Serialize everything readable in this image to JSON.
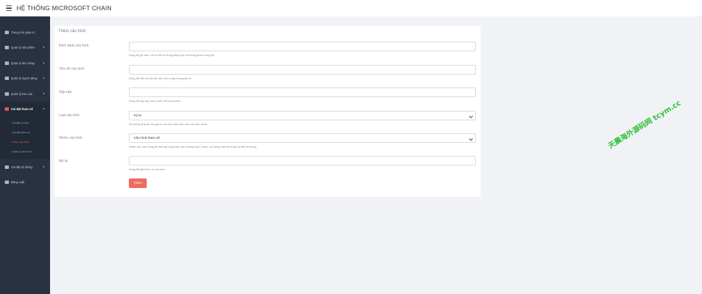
{
  "app": {
    "title": "HỆ THỐNG MICROSOFT CHAIN"
  },
  "sidebar": {
    "items": [
      {
        "label": "Trang chủ quản trị",
        "icon": "dashboard-icon",
        "has_caret": false
      },
      {
        "label": "Quản lý sản phẩm",
        "icon": "box-icon",
        "has_caret": true
      },
      {
        "label": "Quản lý đơn hàng",
        "icon": "file-icon",
        "has_caret": true
      },
      {
        "label": "Quản lý người dùng",
        "icon": "user-icon",
        "has_caret": true
      },
      {
        "label": "Quản lý báo cáo",
        "icon": "chart-icon",
        "has_caret": true
      },
      {
        "label": "Cài đặt tham số",
        "icon": "book-icon",
        "has_caret": true,
        "active": true
      },
      {
        "label": "Cài đặt hệ thống",
        "icon": "gear-icon",
        "has_caret": true
      },
      {
        "label": "Đăng xuất",
        "icon": "logout-icon",
        "has_caret": false
      }
    ],
    "submenu": [
      {
        "label": "Cài đặt cơ bản"
      },
      {
        "label": "Cài đặt tham số"
      },
      {
        "label": "Thêm cấu hình",
        "current": true
      },
      {
        "label": "Quản lý cấu hình"
      }
    ]
  },
  "form": {
    "title": "Thêm cấu hình",
    "fields": [
      {
        "label": "Định danh cấu hình",
        "value": "",
        "help": "Dùng để gọi hàm, chỉ có thể sử dụng tiếng Anh và không được trùng lặp"
      },
      {
        "label": "Tiêu đề cấu hình",
        "value": "",
        "help": "Dùng để hiển thị tiêu đề cấu hình trong trang quản trị"
      },
      {
        "label": "Sắp xếp",
        "value": "",
        "help": "Dùng để sắp xếp thứ tự hiển thị trong nhóm"
      },
      {
        "label": "Loại cấu hình",
        "value": "Ký tự",
        "help": "Hệ thống sẽ phân tích giá trị cấu hình dựa trên các loại khác nhau"
      },
      {
        "label": "Nhóm cấu hình",
        "value": "Cấu hình tham số",
        "help": "Nhóm cấu hình dùng để thiết lập hàng loạt. Nếu không được nhóm, sẽ không hiển thị trong cài đặt hệ thống"
      },
      {
        "label": "Mô tả",
        "value": "",
        "help": "Dùng để giải thích về cấu hình"
      }
    ],
    "submit_label": "Thêm"
  },
  "watermark": {
    "text": "天晨海外源码网 tcym.cc"
  },
  "colors": {
    "accent": "#ec6b62",
    "sidebar_bg": "#2a3241",
    "active_link": "#e05a5a",
    "watermark": "#2cc233"
  }
}
